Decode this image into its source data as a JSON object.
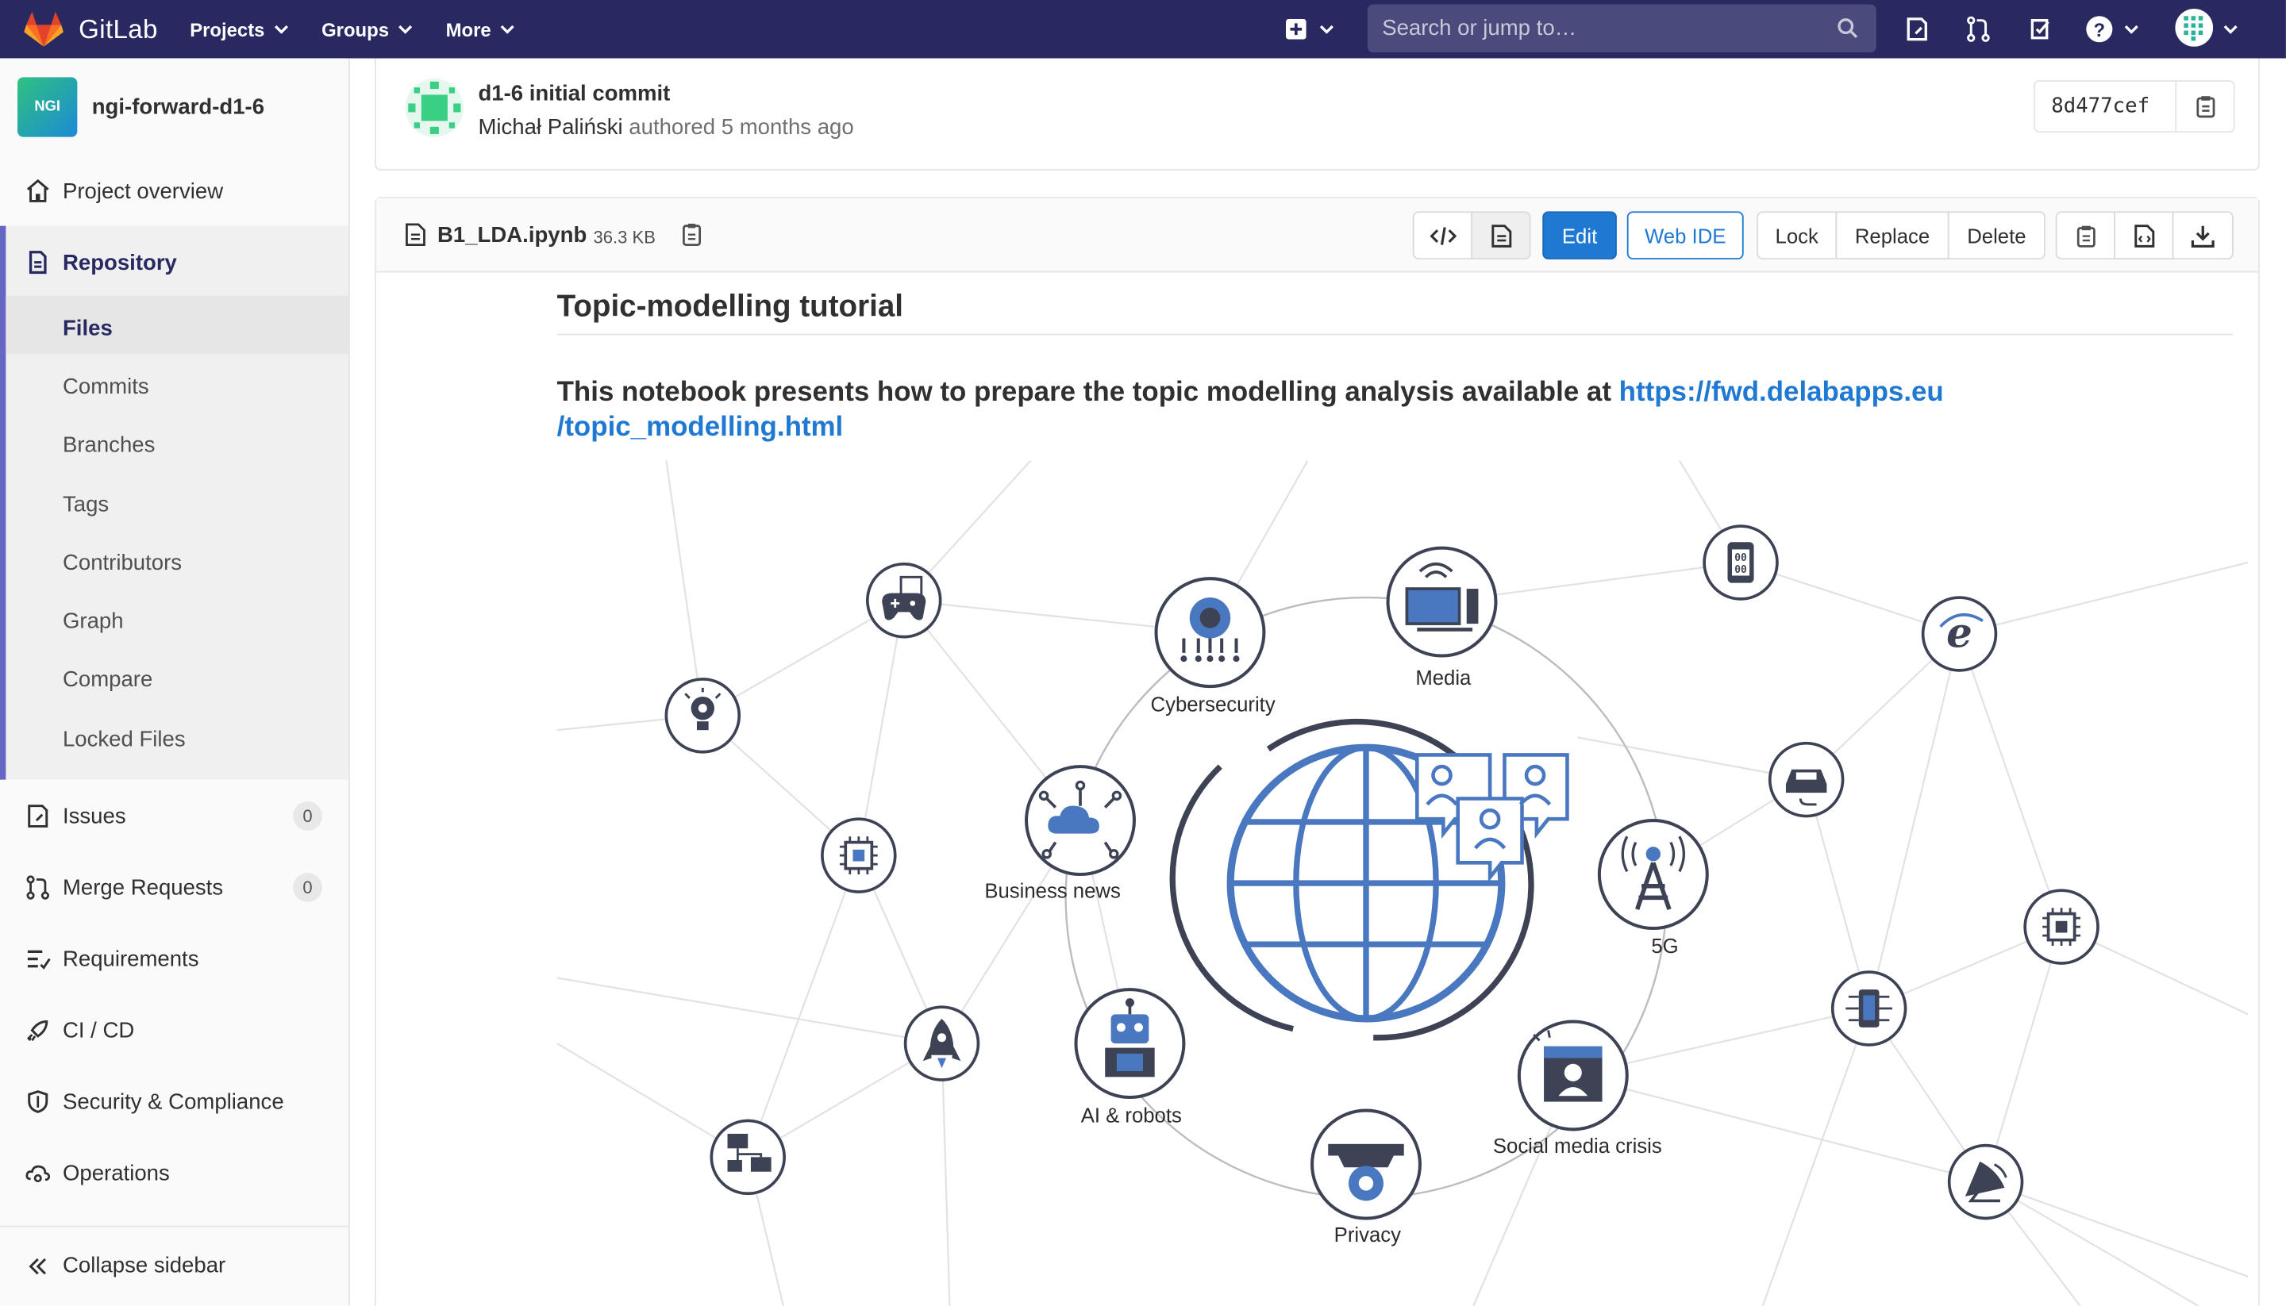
{
  "navbar": {
    "brand": "GitLab",
    "menu": [
      "Projects",
      "Groups",
      "More"
    ],
    "search_placeholder": "Search or jump to…"
  },
  "sidebar": {
    "project_avatar": "NGI",
    "project_name": "ngi-forward-d1-6",
    "items": {
      "overview": "Project overview",
      "repository": "Repository",
      "files": "Files",
      "commits": "Commits",
      "branches": "Branches",
      "tags": "Tags",
      "contributors": "Contributors",
      "graph": "Graph",
      "compare": "Compare",
      "locked": "Locked Files",
      "issues": "Issues",
      "issues_count": "0",
      "merge": "Merge Requests",
      "merge_count": "0",
      "requirements": "Requirements",
      "cicd": "CI / CD",
      "security": "Security & Compliance",
      "operations": "Operations",
      "collapse": "Collapse sidebar"
    }
  },
  "commit": {
    "title": "d1-6 initial commit",
    "author": "Michał Paliński",
    "meta": "authored 5 months ago",
    "sha": "8d477cef"
  },
  "file": {
    "name": "B1_LDA.ipynb",
    "size": "36.3 KB",
    "buttons": {
      "edit": "Edit",
      "webide": "Web IDE",
      "lock": "Lock",
      "replace": "Replace",
      "delete": "Delete"
    }
  },
  "notebook": {
    "title": "Topic-modelling tutorial",
    "intro": "This notebook presents how to prepare the topic modelling analysis available at ",
    "link_line1": "https://fwd.delabapps.eu",
    "link_line2": "/topic_modelling.html"
  },
  "graphic_labels": {
    "cyber": "Cybersecurity",
    "media": "Media",
    "business": "Business news",
    "fiveg": "5G",
    "ai": "AI & robots",
    "social": "Social media crisis",
    "privacy": "Privacy"
  },
  "colors": {
    "navbar": "#292961",
    "accent": "#1f78d1",
    "icon_blue": "#4a78c0",
    "icon_dark": "#3d4354"
  }
}
